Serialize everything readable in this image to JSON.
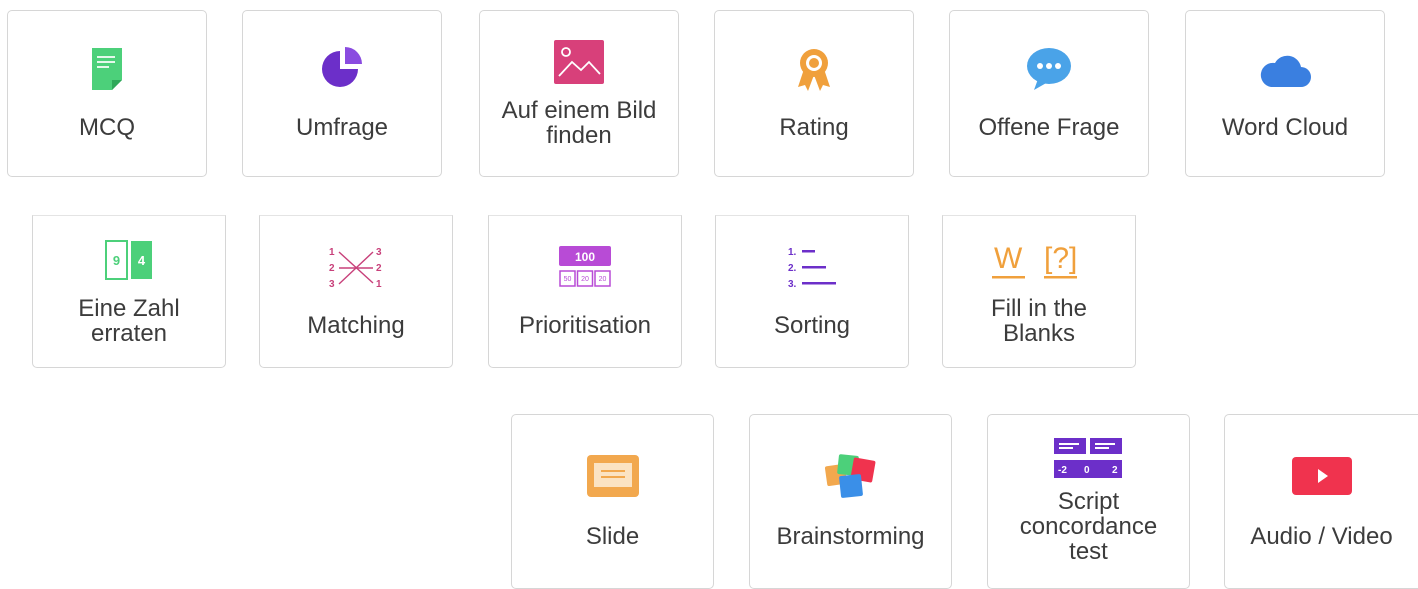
{
  "tiles": {
    "mcq": "MCQ",
    "umfrage": "Umfrage",
    "bild": "Auf einem Bild\nfinden",
    "rating": "Rating",
    "offene": "Offene Frage",
    "wordcloud": "Word Cloud",
    "zahl": "Eine Zahl\nerraten",
    "matching": "Matching",
    "prioritisation": "Prioritisation",
    "sorting": "Sorting",
    "fill": "Fill in the\nBlanks",
    "slide": "Slide",
    "brainstorming": "Brainstorming",
    "script": "Script\nconcordance\ntest",
    "audio": "Audio / Video"
  },
  "icon_text": {
    "zahl_left": "9",
    "zahl_right": "4",
    "prio_top": "100",
    "prio_cells": [
      "50",
      "20",
      "20"
    ],
    "sort_nums": [
      "1.",
      "2.",
      "3."
    ],
    "fill_w": "W",
    "fill_q": "[?]",
    "match_left": [
      "1",
      "2",
      "3"
    ],
    "match_right": [
      "3",
      "2",
      "1"
    ],
    "script_scale": [
      "-2",
      "0",
      "2"
    ]
  },
  "icons": {
    "mcq": "document-icon",
    "umfrage": "pie-chart-icon",
    "bild": "image-icon",
    "rating": "award-ribbon-icon",
    "offene": "speech-bubble-icon",
    "wordcloud": "cloud-icon",
    "zahl": "number-cards-icon",
    "matching": "matching-icon",
    "prioritisation": "points-allocation-icon",
    "sorting": "ordered-list-icon",
    "fill": "fill-blank-icon",
    "slide": "slide-icon",
    "brainstorming": "sticky-notes-icon",
    "script": "scale-icon",
    "audio": "play-icon"
  },
  "colors": {
    "green": "#4cd07a",
    "purple": "#7a3fd1",
    "pink": "#d8407a",
    "orange": "#f0a03c",
    "blue": "#4aa3e8",
    "magenta": "#b84bd6",
    "red": "#f0334e"
  }
}
